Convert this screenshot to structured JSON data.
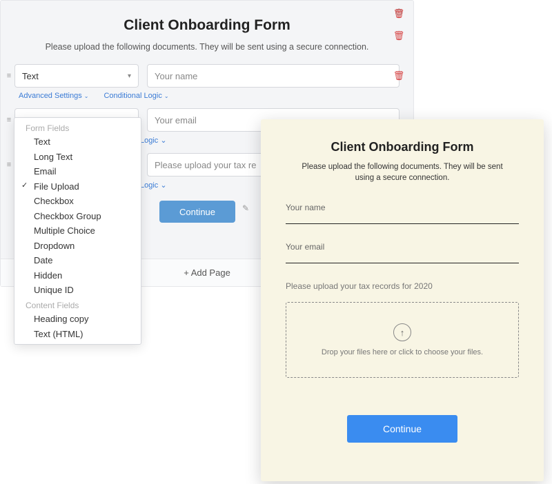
{
  "builder": {
    "title": "Client Onboarding Form",
    "subtitle": "Please upload the following documents. They will be sent using a secure connection.",
    "advanced_settings": "Advanced Settings",
    "conditional_logic": "Conditional Logic",
    "logic_short": "Logic",
    "continue": "Continue",
    "add_page": "+ Add Page",
    "fields": [
      {
        "type": "Text",
        "placeholder": "Your name"
      },
      {
        "type": "",
        "placeholder": "Your email"
      },
      {
        "type": "",
        "placeholder": "Please upload your tax re"
      }
    ]
  },
  "dropdown": {
    "group1": "Form Fields",
    "group2": "Content Fields",
    "items1": [
      "Text",
      "Long Text",
      "Email",
      "File Upload",
      "Checkbox",
      "Checkbox Group",
      "Multiple Choice",
      "Dropdown",
      "Date",
      "Hidden",
      "Unique ID"
    ],
    "items2": [
      "Heading copy",
      "Text (HTML)"
    ],
    "selected": "File Upload"
  },
  "preview": {
    "title": "Client Onboarding Form",
    "subtitle": "Please upload the following documents. They will be sent using a secure connection.",
    "name_label": "Your name",
    "email_label": "Your email",
    "upload_label": "Please upload your tax records for 2020",
    "dropzone_text": "Drop your files here or click to choose your files.",
    "continue": "Continue"
  }
}
